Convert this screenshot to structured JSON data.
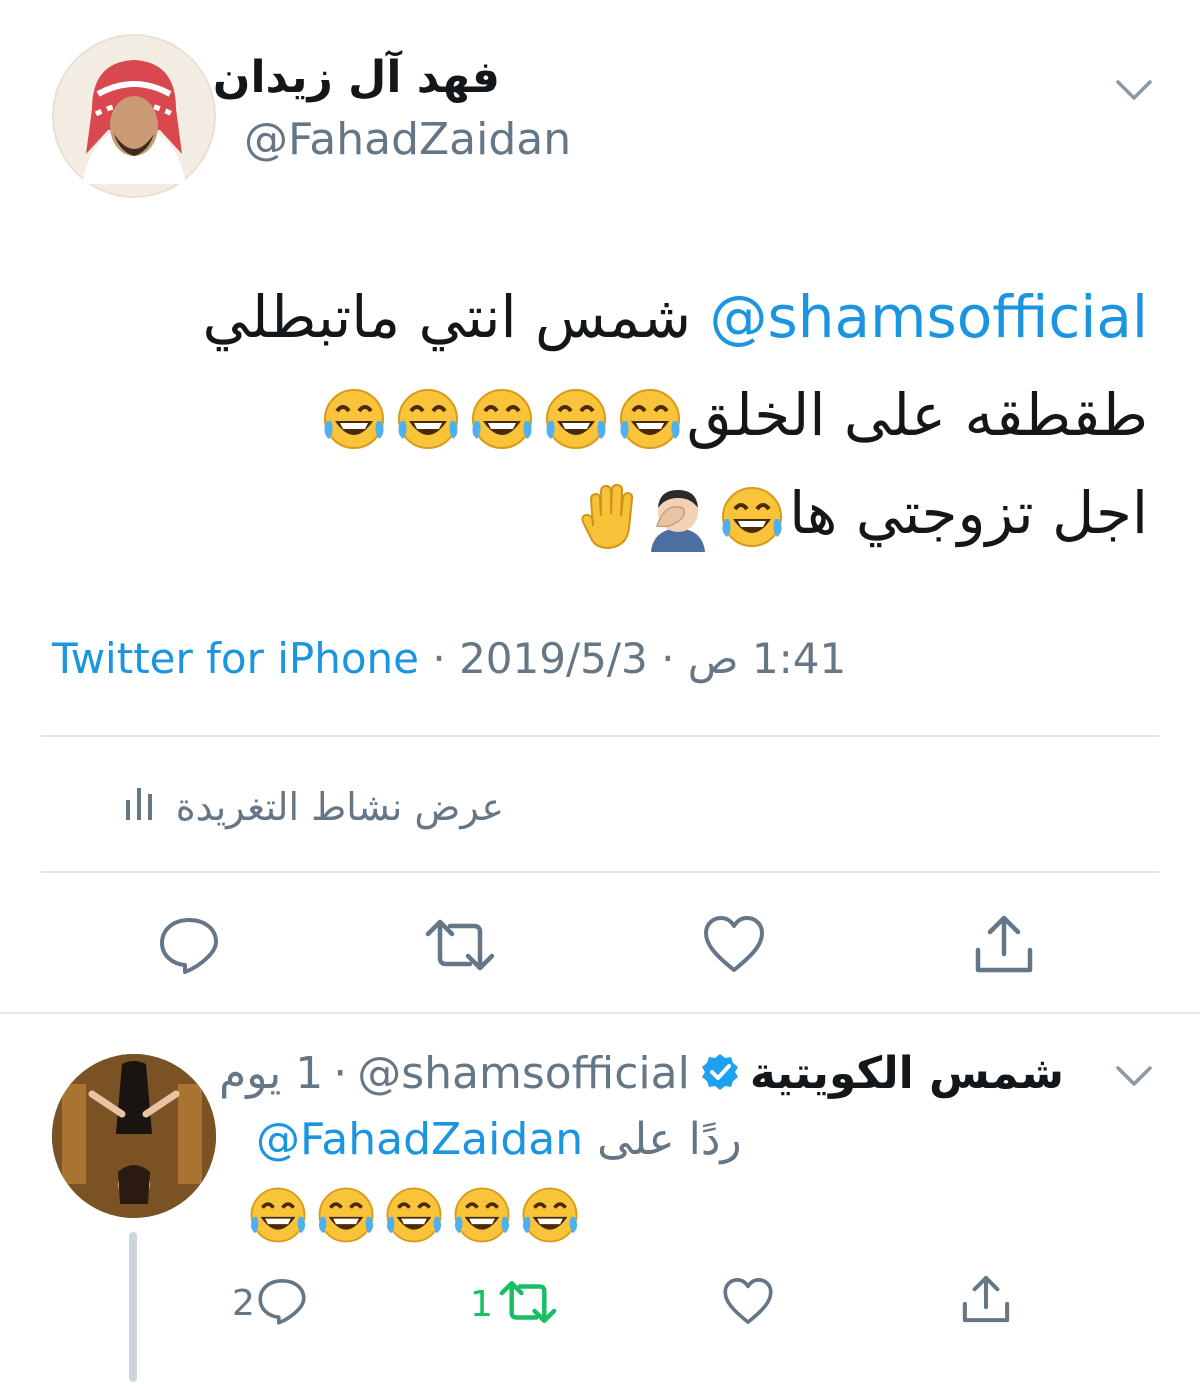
{
  "main_tweet": {
    "author_name": "فهد آل زيدان",
    "author_handle": "@FahadZaidan",
    "text_mention": "@shamsofficial",
    "text_line1": "شمس انتي ماتبطلي",
    "text_line2": "طقطقه على الخلق",
    "text_line3": "اجل تزوجتي ها",
    "source": "Twitter for iPhone",
    "date": "2019/5/3",
    "time": "1:41 ص",
    "separator": "·",
    "activity_label": "عرض نشاط التغريدة"
  },
  "reply_tweet": {
    "author_name": "شمس الكويتية",
    "verified": true,
    "author_handle": "@shamsofficial",
    "age": "1 يوم",
    "separator": "·",
    "reply_to_label": "ردًا على",
    "reply_to_handle": "@FahadZaidan",
    "reply_count": "2",
    "retweet_count": "1",
    "like_count": ""
  },
  "icons": {
    "reply": "reply-icon",
    "retweet": "retweet-icon",
    "like": "heart-icon",
    "share": "share-icon",
    "chevron": "chevron-down-icon",
    "activity": "bar-chart-icon",
    "verified": "verified-badge-icon"
  },
  "colors": {
    "link": "#1b95e0",
    "muted": "#657786",
    "divider": "#e1e8ed",
    "retweet_active": "#17bf63",
    "verified": "#1da1f2"
  }
}
